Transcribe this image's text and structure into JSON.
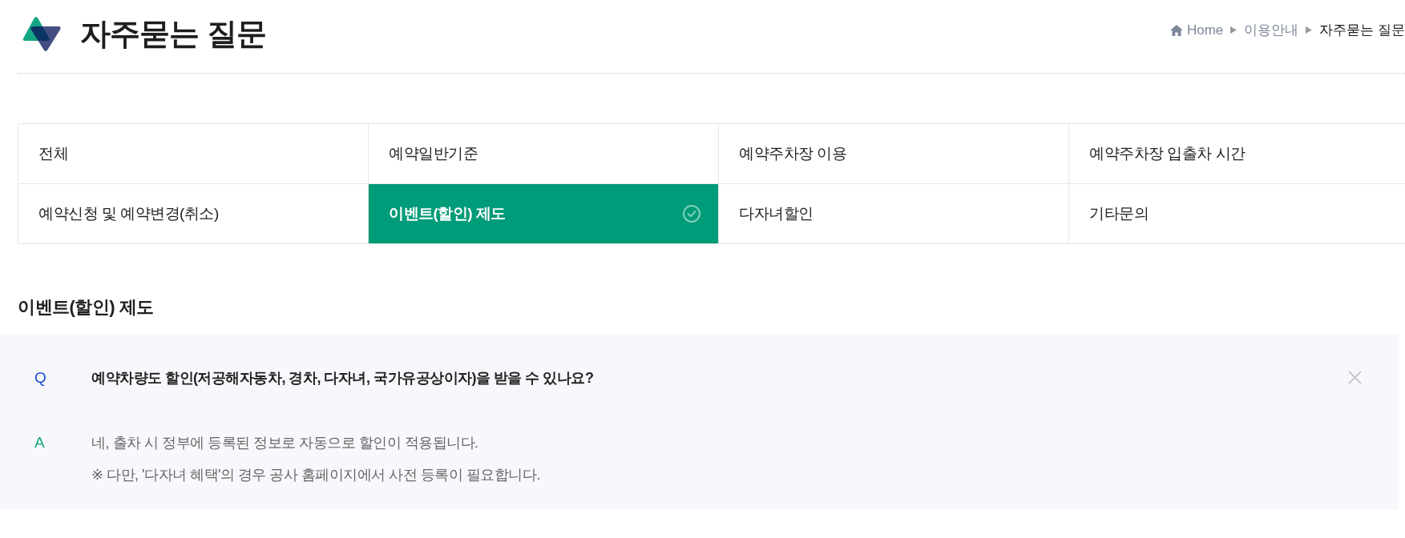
{
  "header": {
    "title": "자주묻는 질문",
    "breadcrumb": [
      {
        "label": "Home",
        "kind": "home"
      },
      {
        "label": "이용안내",
        "kind": "link"
      },
      {
        "label": "자주묻는 질문",
        "kind": "current"
      }
    ]
  },
  "categories": [
    {
      "label": "전체",
      "selected": false
    },
    {
      "label": "예약일반기준",
      "selected": false
    },
    {
      "label": "예약주차장 이용",
      "selected": false
    },
    {
      "label": "예약주차장 입출차 시간",
      "selected": false
    },
    {
      "label": "예약신청 및 예약변경(취소)",
      "selected": false
    },
    {
      "label": "이벤트(할인) 제도",
      "selected": true
    },
    {
      "label": "다자녀할인",
      "selected": false
    },
    {
      "label": "기타문의",
      "selected": false
    }
  ],
  "section_title": "이벤트(할인) 제도",
  "faq": [
    {
      "q_mark": "Q",
      "question": "예약차량도 할인(저공해자동차, 경차, 다자녀, 국가유공상이자)을 받을 수 있나요?",
      "expanded": true,
      "a_mark": "A",
      "answer": [
        "네, 출차 시 정부에 등록된 정보로 자동으로 할인이 적용됩니다.",
        "※ 다만, '다자녀 혜택'의 경우 공사 홈페이지에서 사전 등록이 필요합니다."
      ]
    }
  ]
}
